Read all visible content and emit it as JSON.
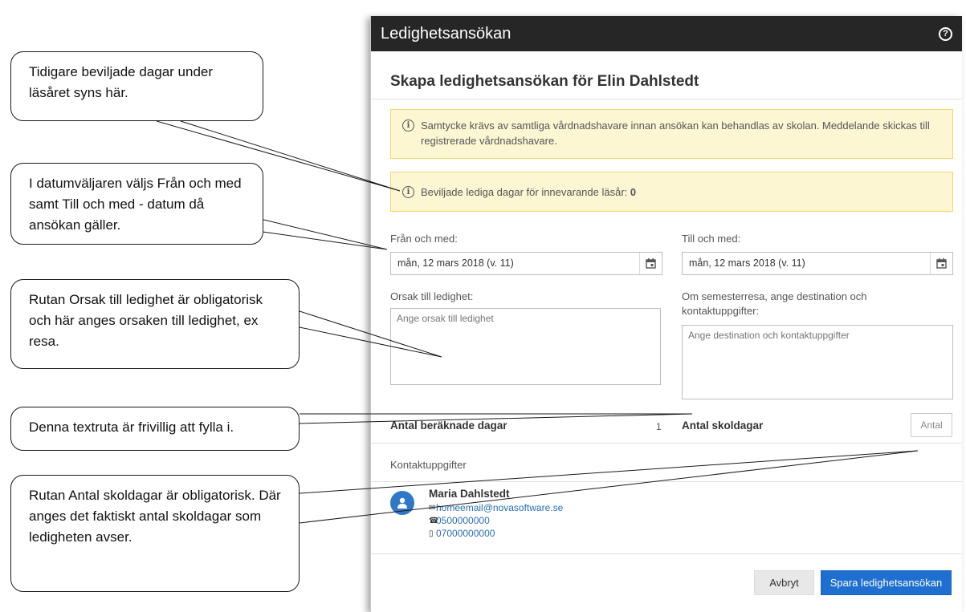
{
  "dialog": {
    "title": "Ledighetsansökan",
    "help_icon_glyph": "?",
    "heading": "Skapa ledighetsansökan för Elin Dahlstedt",
    "alerts": {
      "consent_text": "Samtycke krävs av samtliga vårdnadshavare innan ansökan kan behandlas av skolan. Meddelande skickas till registrerade vårdnadshavare.",
      "approved_days_text": "Beviljade lediga dagar för innevarande läsår:",
      "approved_days_value": "0",
      "info_icon_glyph": "i"
    },
    "from": {
      "label": "Från och med:",
      "value": "mån, 12 mars 2018 (v. 11)"
    },
    "to": {
      "label": "Till och med:",
      "value": "mån, 12 mars 2018 (v. 11)"
    },
    "reason": {
      "label": "Orsak till ledighet:",
      "placeholder": "Ange orsak till ledighet"
    },
    "destination": {
      "label": "Om semesterresa, ange destination och kontaktuppgifter:",
      "placeholder": "Ange destination och kontaktuppgifter"
    },
    "calculated_days": {
      "label": "Antal beräknade dagar",
      "value": "1"
    },
    "school_days": {
      "label": "Antal skoldagar",
      "placeholder": "Antal"
    },
    "contacts": {
      "label": "Kontaktuppgifter",
      "name": "Maria Dahlstedt",
      "email": "homeemail@novasoftware.se",
      "phone": "0500000000",
      "mobile": "07000000000"
    },
    "buttons": {
      "cancel": "Avbryt",
      "save": "Spara ledighetsansökan"
    }
  },
  "callouts": {
    "c1": "Tidigare beviljade dagar under läsåret syns här.",
    "c2": "I datumväljaren väljs Från och med samt Till och med - datum då ansökan gäller.",
    "c3": "Rutan Orsak till ledighet är obligatorisk och här anges orsaken till ledighet, ex resa.",
    "c4": "Denna textruta är frivillig att fylla i.",
    "c5": "Rutan Antal skoldagar är obligatorisk. Där anges det faktiskt antal skoldagar som ledigheten avser."
  },
  "icons": {
    "help": "help-circle-icon",
    "info": "info-circle-icon",
    "calendar": "calendar-icon",
    "avatar": "user-avatar-icon",
    "email": "envelope-icon",
    "phone": "phone-icon",
    "mobile": "mobile-phone-icon"
  },
  "colors": {
    "titlebar": "#262626",
    "alert_bg": "#fcf6d2",
    "alert_border": "#f1d86f",
    "primary": "#1f6fd1",
    "link": "#2a6db5"
  }
}
